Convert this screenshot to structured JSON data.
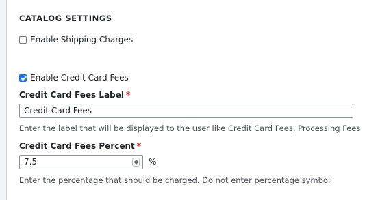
{
  "section": {
    "title": "CATALOG SETTINGS"
  },
  "shipping": {
    "label": "Enable Shipping Charges",
    "checked": false
  },
  "credit_card": {
    "label": "Enable Credit Card Fees",
    "checked": true
  },
  "fees_label_field": {
    "label": "Credit Card Fees Label",
    "required_mark": "*",
    "value": "Credit Card Fees",
    "description": "Enter the label that will be displayed to the user like Credit Card Fees, Processing Fees"
  },
  "fees_percent_field": {
    "label": "Credit Card Fees Percent",
    "required_mark": "*",
    "value": "7.5",
    "suffix": "%",
    "description": "Enter the percentage that should be charged. Do not enter percentage symbol"
  },
  "colors": {
    "accent": "#1a73e8",
    "required": "#dc2323"
  }
}
